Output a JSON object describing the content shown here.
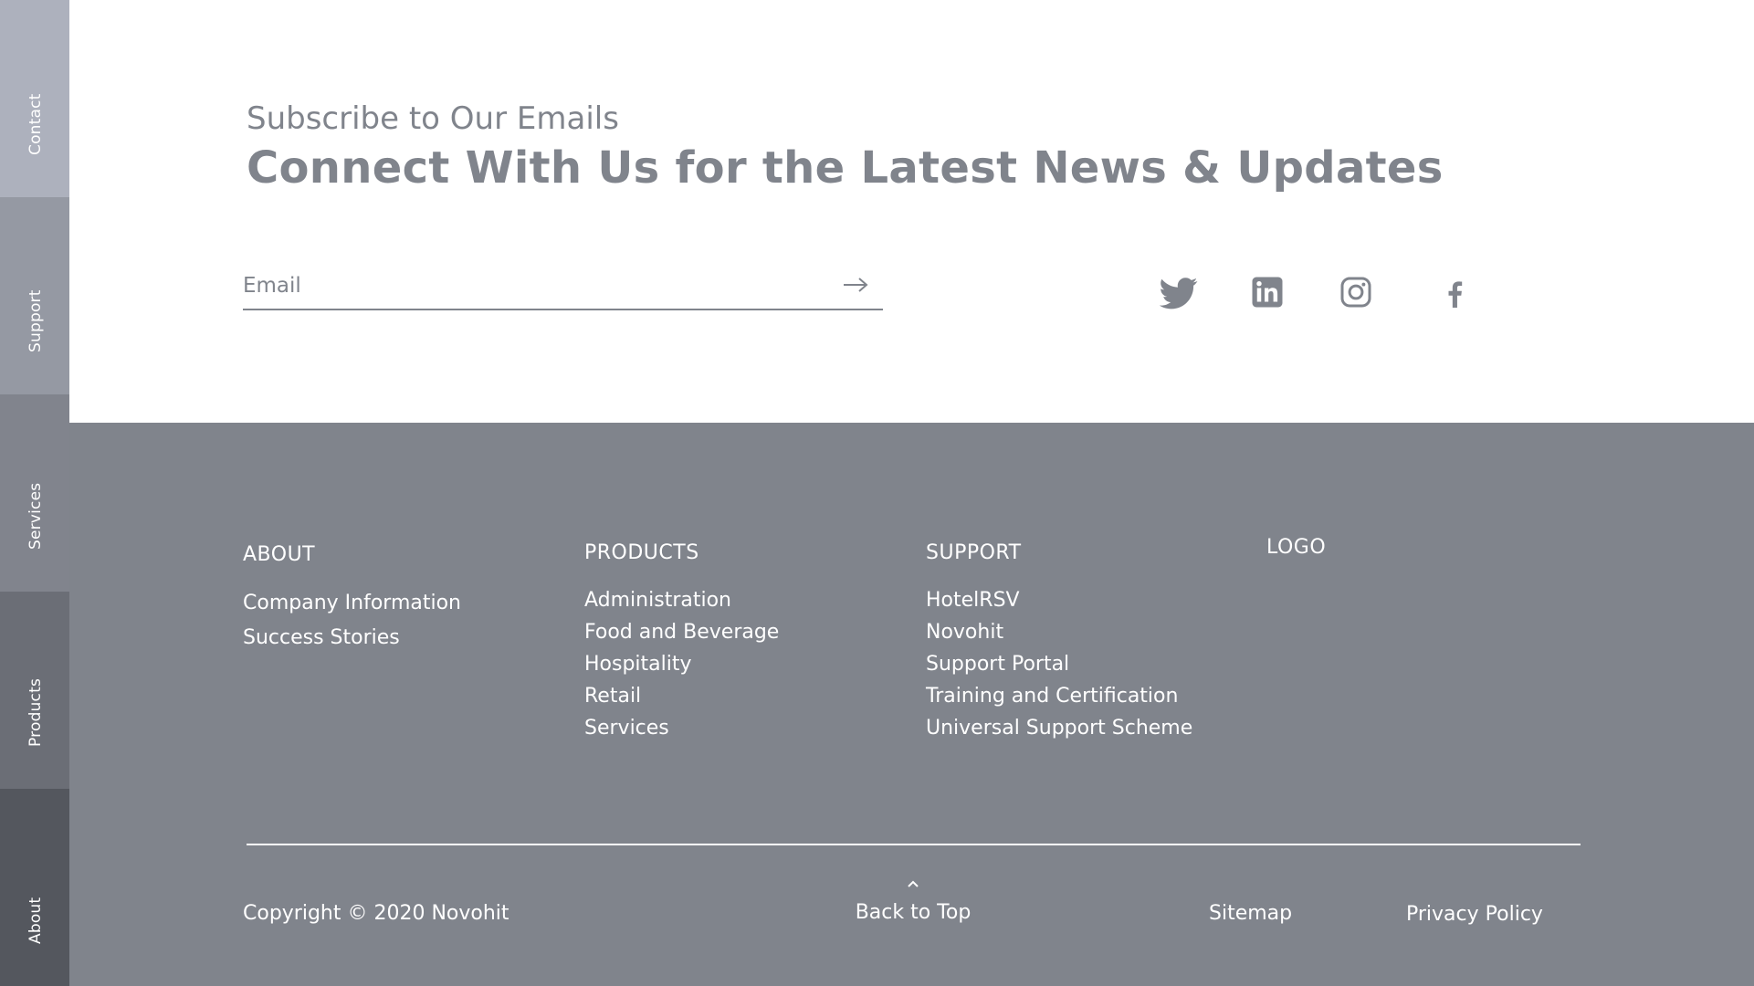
{
  "side_nav": {
    "items": [
      {
        "label": "Contact"
      },
      {
        "label": "Support"
      },
      {
        "label": "Services"
      },
      {
        "label": "Products"
      },
      {
        "label": "About"
      }
    ]
  },
  "subscribe": {
    "eyebrow": "Subscribe to Our Emails",
    "title": "Connect With Us for the Latest News & Updates",
    "email_placeholder": "Email",
    "email_value": "",
    "submit_icon": "arrow-right-icon"
  },
  "social": {
    "icons": [
      "twitter-icon",
      "linkedin-icon",
      "instagram-icon",
      "facebook-icon"
    ]
  },
  "footer": {
    "about": {
      "heading": "ABOUT",
      "links": [
        "Company Information",
        "Success Stories"
      ]
    },
    "products": {
      "heading": "PRODUCTS",
      "links": [
        "Administration",
        "Food and Beverage",
        "Hospitality",
        "Retail",
        "Services"
      ]
    },
    "support": {
      "heading": "SUPPORT",
      "links": [
        "HotelRSV",
        "Novohit",
        "Support Portal",
        "Training and Certification",
        "Universal Support Scheme"
      ]
    },
    "logo": "LOGO",
    "copyright": "Copyright © 2020 Novohit",
    "back_to_top": "Back to Top",
    "sitemap": "Sitemap",
    "privacy": "Privacy Policy"
  },
  "colors": {
    "text_gray": "#80848c",
    "footer_bg": "#80848c",
    "white": "#ffffff",
    "nav_contact": "#adb1bd",
    "nav_support": "#9599a3",
    "nav_services": "#81848d",
    "nav_products": "#6b6e76",
    "nav_about": "#54575e"
  }
}
